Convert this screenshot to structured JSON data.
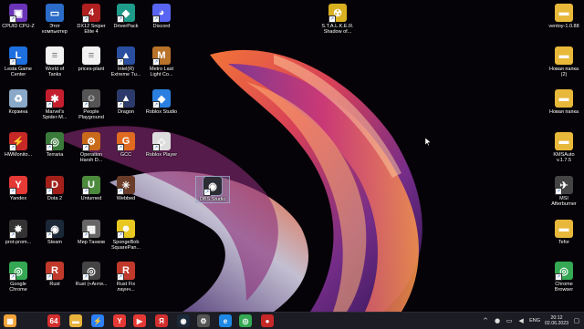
{
  "desktop": {
    "icons": [
      {
        "label": "CPUID CPU-Z",
        "icon": "cpuz-icon"
      },
      {
        "label": "Этот компьютер",
        "icon": "this-pc-icon"
      },
      {
        "label": "DX12 Sniper Elite 4",
        "icon": "sniper-elite-icon"
      },
      {
        "label": "DriverPack",
        "icon": "driverpack-icon"
      },
      {
        "label": "Discord",
        "icon": "discord-icon"
      },
      {
        "label": "S.T.A.L.K.E.R. Shadow of...",
        "icon": "stalker-icon"
      },
      {
        "label": "ventoy-1.0.88",
        "icon": "folder-icon"
      },
      {
        "label": "Lesta Game Center",
        "icon": "lesta-icon"
      },
      {
        "label": "World of Tanks",
        "icon": "document-icon"
      },
      {
        "label": "prices-plant",
        "icon": "document-icon"
      },
      {
        "label": "Intel(R) Extreme Tu...",
        "icon": "intel-icon"
      },
      {
        "label": "Metro Last Light Co...",
        "icon": "metro-icon"
      },
      {
        "label": "Новая папка (2)",
        "icon": "folder-icon"
      },
      {
        "label": "Корзина",
        "icon": "recycle-bin-icon"
      },
      {
        "label": "Marvel's Spider-M...",
        "icon": "spiderman-icon"
      },
      {
        "label": "People Playground",
        "icon": "people-playground-icon"
      },
      {
        "label": "Dragon",
        "icon": "dragon-icon"
      },
      {
        "label": "Roblox Studio",
        "icon": "roblox-studio-icon"
      },
      {
        "label": "Новая папка",
        "icon": "folder-icon"
      },
      {
        "label": "HWMonito...",
        "icon": "hwmonitor-icon"
      },
      {
        "label": "Terraria",
        "icon": "terraria-icon"
      },
      {
        "label": "Operation Harsh D...",
        "icon": "operation-harsh-icon"
      },
      {
        "label": "GCC",
        "icon": "gcc-icon"
      },
      {
        "label": "Roblox Player",
        "icon": "roblox-player-icon"
      },
      {
        "label": "KMSAuto v.1.7.5",
        "icon": "folder-icon"
      },
      {
        "label": "OBS Studio",
        "icon": "obs-icon"
      },
      {
        "label": "Yandex",
        "icon": "yandex-icon"
      },
      {
        "label": "Dota 2",
        "icon": "dota2-icon"
      },
      {
        "label": "Unturned",
        "icon": "unturned-icon"
      },
      {
        "label": "Webbed",
        "icon": "webbed-icon"
      },
      {
        "label": "MSI Afterburner",
        "icon": "msi-afterburner-icon"
      },
      {
        "label": "prot-prom...",
        "icon": "prot-prom-icon"
      },
      {
        "label": "Steam",
        "icon": "steam-icon"
      },
      {
        "label": "Мир Танков",
        "icon": "mir-tankov-icon"
      },
      {
        "label": "SpongeBob SquarePan...",
        "icon": "spongebob-icon"
      },
      {
        "label": "Tefor",
        "icon": "folder-icon"
      },
      {
        "label": "Google Chrome",
        "icon": "chrome-icon"
      },
      {
        "label": "Rust",
        "icon": "rust-icon"
      },
      {
        "label": "Rust (+Анти...",
        "icon": "rust-anti-icon"
      },
      {
        "label": "Rust Fix лаунч...",
        "icon": "rust-fix-icon"
      },
      {
        "label": "Chrome Browser",
        "icon": "chrome-icon"
      }
    ]
  },
  "taskbar": {
    "apps": [
      {
        "name": "start-button",
        "glyph": "▦",
        "color": "#f2a33a"
      },
      {
        "name": "taskbar-64-app",
        "glyph": "64",
        "color": "#d32f2f"
      },
      {
        "name": "taskbar-folder-app",
        "glyph": "▬",
        "color": "#e7b33c"
      },
      {
        "name": "taskbar-lightning-app",
        "glyph": "⚡",
        "color": "#2d7ff9"
      },
      {
        "name": "taskbar-yandex-app",
        "glyph": "Y",
        "color": "#e53935"
      },
      {
        "name": "taskbar-media-app",
        "glyph": "▶",
        "color": "#e53935"
      },
      {
        "name": "taskbar-yandex-browser-app",
        "glyph": "Я",
        "color": "#d32f2f"
      },
      {
        "name": "taskbar-steam-app",
        "glyph": "◉",
        "color": "#1b2838"
      },
      {
        "name": "taskbar-gear-app",
        "glyph": "⚙",
        "color": "#555"
      },
      {
        "name": "taskbar-edge-app",
        "glyph": "e",
        "color": "#1e88e5"
      },
      {
        "name": "taskbar-chrome-app",
        "glyph": "◎",
        "color": "#34a853"
      },
      {
        "name": "taskbar-record-app",
        "glyph": "●",
        "color": "#c62828"
      }
    ],
    "tray": {
      "language": "ENG",
      "time": "20:12",
      "date": "02.06.2023"
    }
  },
  "colors": {
    "taskbar": "#1c1c24",
    "wallpaper_base": "#060308"
  }
}
